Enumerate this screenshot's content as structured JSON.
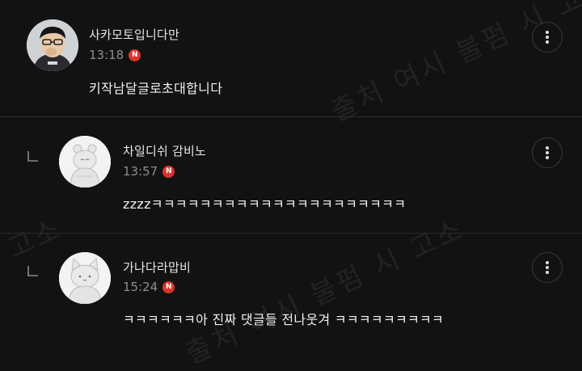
{
  "comments": [
    {
      "nickname": "사카모토입니다만",
      "time": "13:18",
      "badge": "N",
      "text": "키작남달글로초대합니다",
      "avatar_icon": "profile-photo-icon"
    },
    {
      "nickname": "차일디쉬 감비노",
      "time": "13:57",
      "badge": "N",
      "text": "zzzzㅋㅋㅋㅋㅋㅋㅋㅋㅋㅋㅋㅋㅋㅋㅋㅋㅋㅋㅋㅋㅋ",
      "avatar_icon": "default-avatar-icon"
    },
    {
      "nickname": "가나다라맙비",
      "time": "15:24",
      "badge": "N",
      "text": "ㅋㅋㅋㅋㅋㅋ아 진짜 댓글들 전나웃겨 ㅋㅋㅋㅋㅋㅋㅋㅋㅋ",
      "avatar_icon": "default-avatar-icon"
    }
  ],
  "watermark": {
    "text_a": "출처 여시 불펌 시 고소",
    "text_b": "고소"
  },
  "colors": {
    "background": "#121213",
    "badge": "#e0332b",
    "time": "#8d8d8f"
  }
}
